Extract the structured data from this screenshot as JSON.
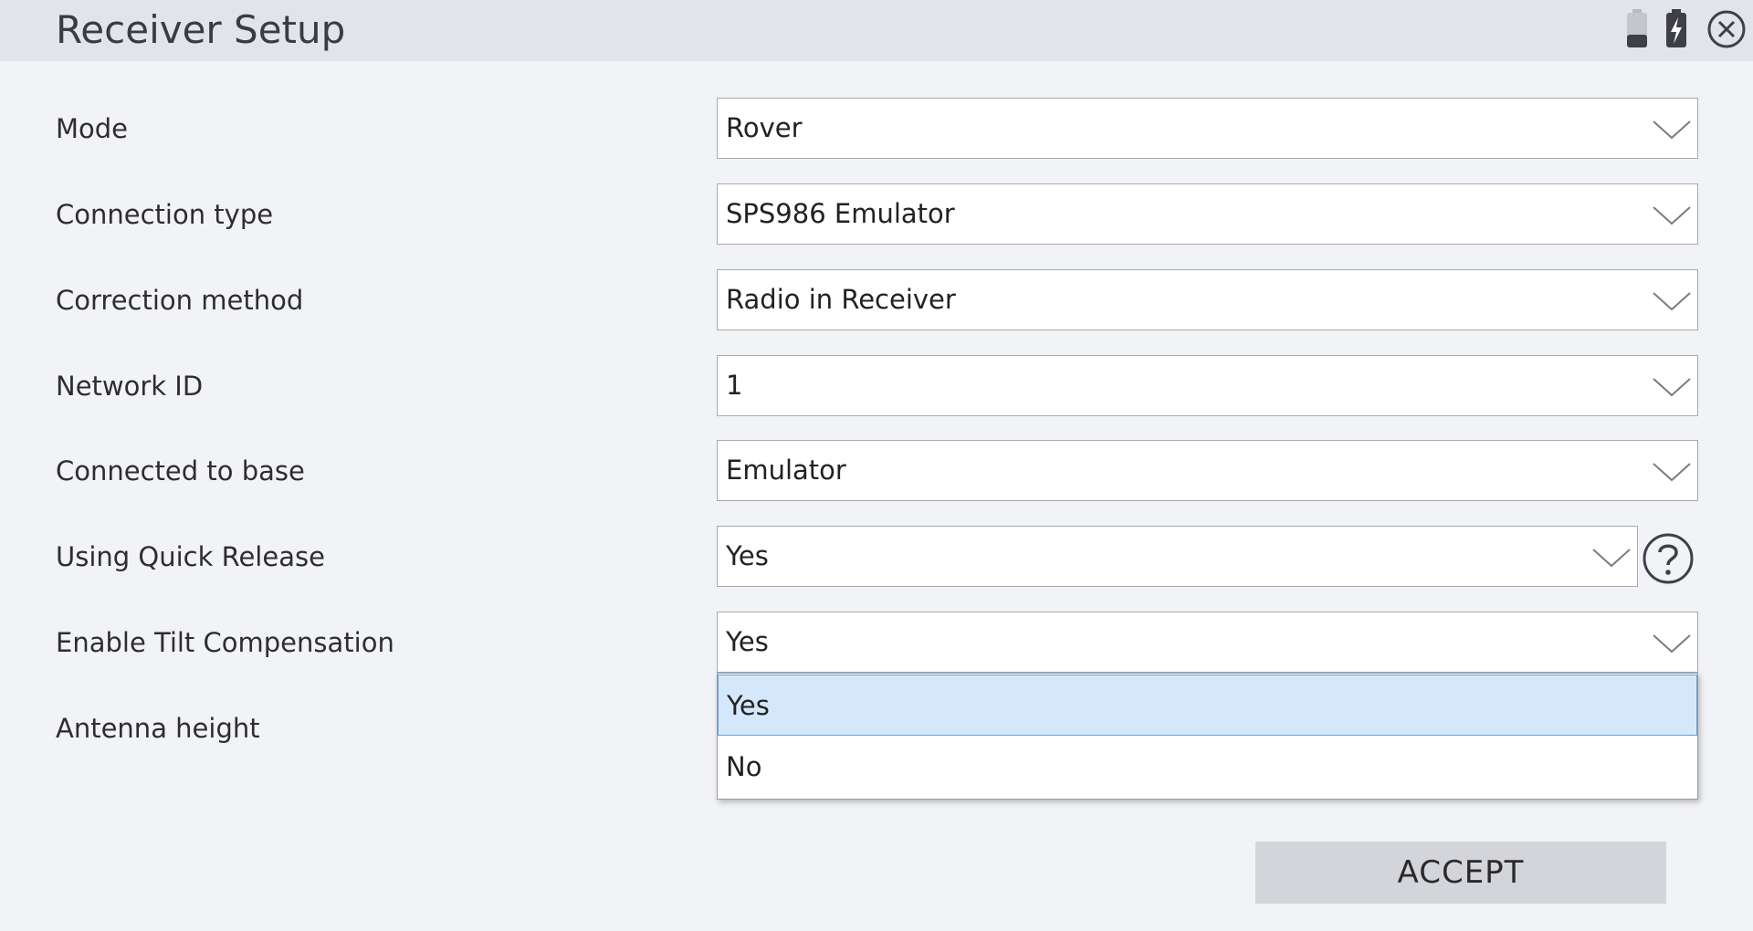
{
  "header": {
    "title": "Receiver Setup",
    "icons": [
      "battery-icon",
      "battery-charging-icon",
      "close-icon"
    ]
  },
  "form": {
    "rows": [
      {
        "label": "Mode",
        "value": "Rover"
      },
      {
        "label": "Connection type",
        "value": "SPS986 Emulator"
      },
      {
        "label": "Correction method",
        "value": "Radio in Receiver"
      },
      {
        "label": "Network ID",
        "value": "1"
      },
      {
        "label": "Connected to base",
        "value": "Emulator"
      },
      {
        "label": "Using Quick Release",
        "value": "Yes"
      },
      {
        "label": "Enable Tilt Compensation",
        "value": "Yes"
      },
      {
        "label": "Antenna height",
        "value": ""
      }
    ]
  },
  "dropdown": {
    "options": [
      "Yes",
      "No"
    ],
    "selected": "Yes"
  },
  "footer": {
    "accept_label": "ACCEPT"
  },
  "colors": {
    "background": "#f2f3f6",
    "titlebar": "#e3e4e9",
    "selected_option": "#d5e8fb",
    "selected_border": "#5ea2e0",
    "button": "#d4d5da"
  }
}
